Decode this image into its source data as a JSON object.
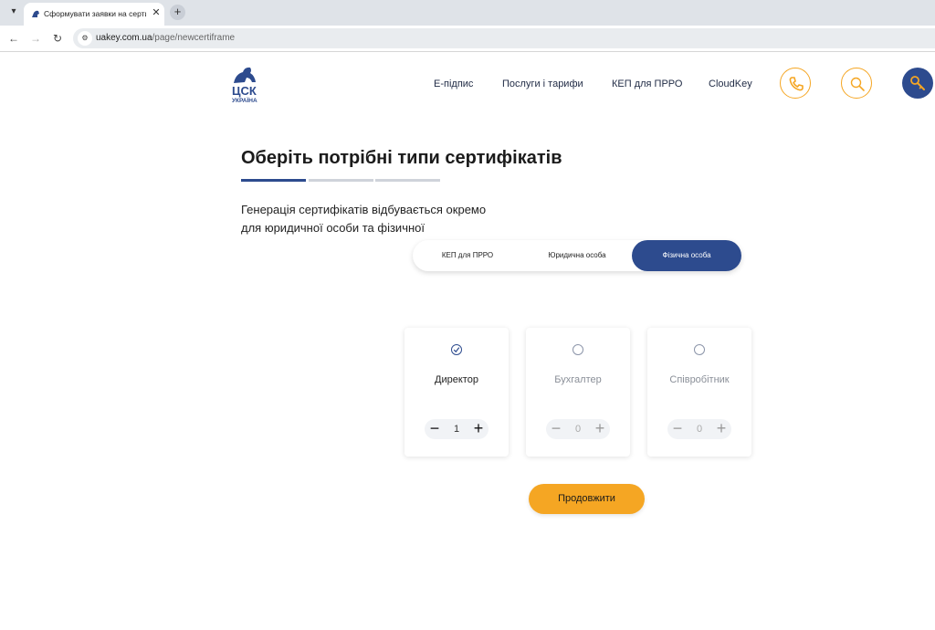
{
  "browser": {
    "tab_title": "Сформувати заявки на сертиф",
    "url_host": "uakey.com.ua",
    "url_path": "/page/newcertiframe"
  },
  "header": {
    "logo_text": "ЦСК УКРАЇНА",
    "nav": [
      "Е-підпис",
      "Послуги і тарифи",
      "КЕП для ПРРО",
      "CloudKey"
    ],
    "accent_color": "#f5a623",
    "brand_color": "#2d4b8e"
  },
  "main": {
    "title": "Оберіть потрібні типи сертифікатів",
    "steps_total": 3,
    "steps_active": 1,
    "desc_line1": "Генерація сертифікатів відбувається окремо",
    "desc_line2": "для юридичної особи та фізичної",
    "segments": [
      {
        "label": "КЕП для ПРРО",
        "active": false
      },
      {
        "label": "Юридична особа",
        "active": false
      },
      {
        "label": "Фізична особа",
        "active": true
      }
    ],
    "cards": [
      {
        "label": "Директор",
        "selected": true,
        "qty": "1"
      },
      {
        "label": "Бухгалтер",
        "selected": false,
        "qty": "0"
      },
      {
        "label": "Співробітник",
        "selected": false,
        "qty": "0"
      }
    ],
    "stepper": {
      "minus": "−",
      "plus": "+"
    },
    "continue_label": "Продовжити"
  }
}
